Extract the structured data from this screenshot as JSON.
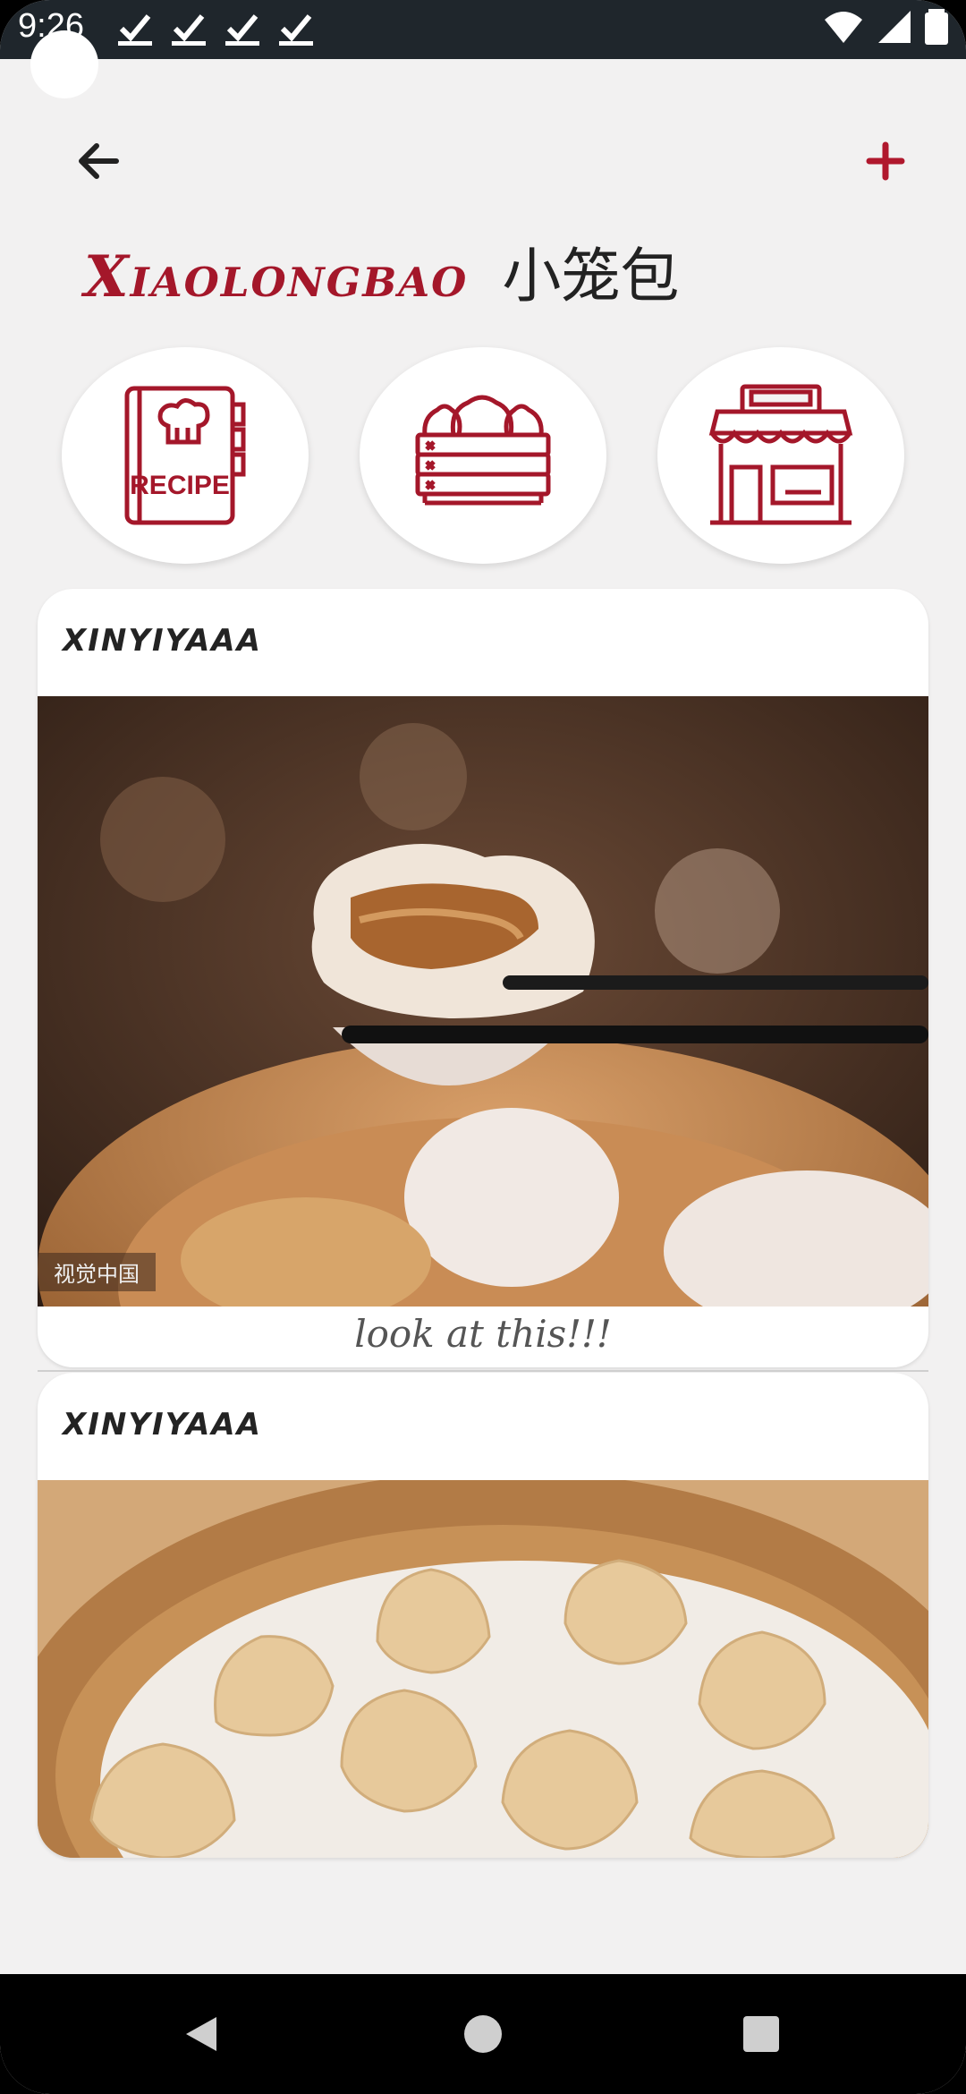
{
  "status_bar": {
    "time": "9:26",
    "notification_count": 4
  },
  "header": {
    "title_en": "Xiaolongbao",
    "title_cn": "小笼包"
  },
  "categories": [
    {
      "icon": "recipe-book-icon",
      "label": "RECIPE"
    },
    {
      "icon": "dumpling-steamer-icon"
    },
    {
      "icon": "restaurant-store-icon"
    }
  ],
  "posts": [
    {
      "user": "xinyiyaaa",
      "photo_watermark": "视觉中国",
      "caption": "look at this!!!"
    },
    {
      "user": "xinyiyaaa"
    }
  ],
  "colors": {
    "accent": "#a4172a",
    "background": "#f2f1f1",
    "card": "#ffffff"
  }
}
